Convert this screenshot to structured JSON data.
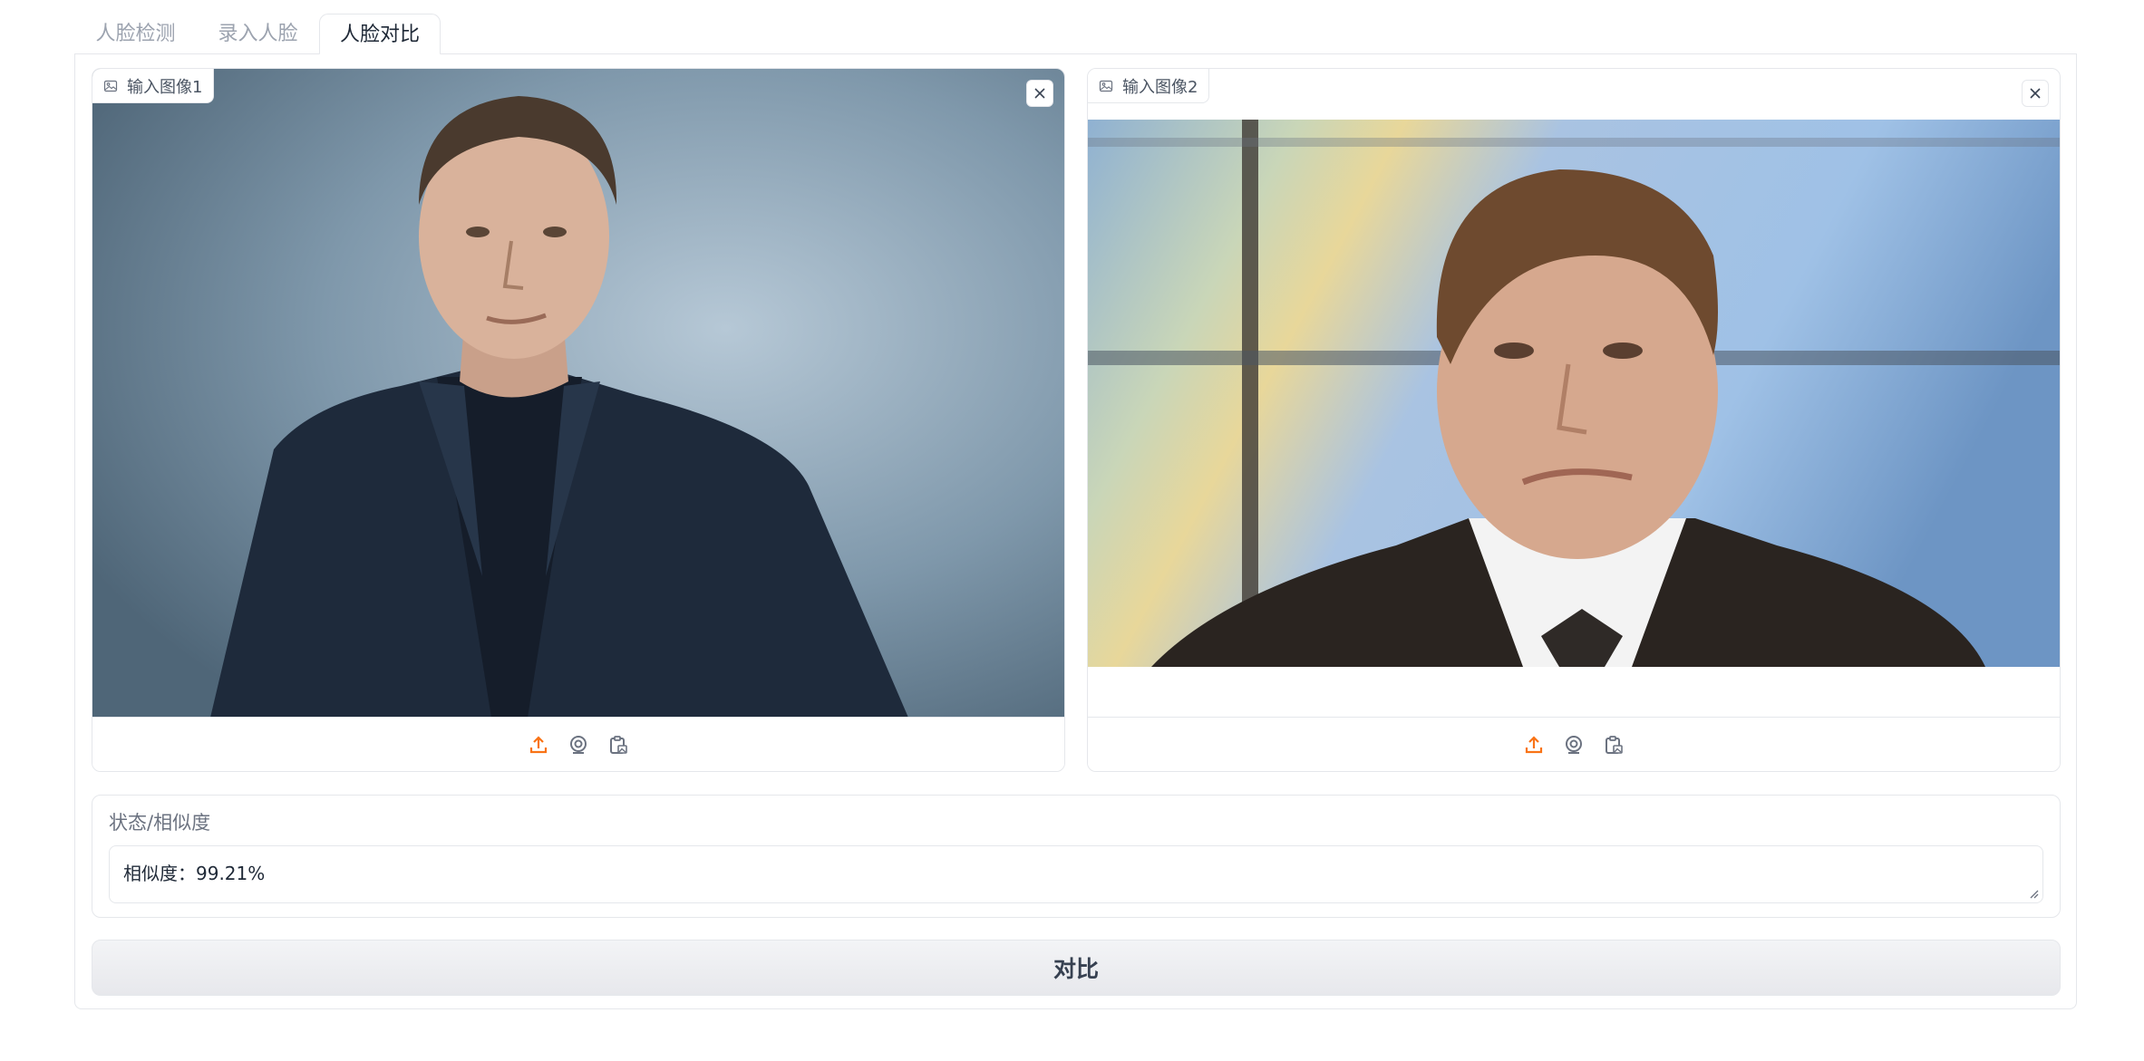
{
  "tabs": [
    {
      "label": "人脸检测",
      "active": false
    },
    {
      "label": "录入人脸",
      "active": false
    },
    {
      "label": "人脸对比",
      "active": true
    }
  ],
  "images": [
    {
      "label": "输入图像1",
      "subject": "man in dark suit on grey-blue studio background"
    },
    {
      "label": "输入图像2",
      "subject": "man in suit and tie in front of colorful window"
    }
  ],
  "source_buttons": [
    "upload-icon",
    "webcam-icon",
    "clipboard-icon"
  ],
  "status": {
    "label": "状态/相似度",
    "value": "相似度：99.21%"
  },
  "compare_button": {
    "label": "对比"
  },
  "colors": {
    "accent": "#f97316",
    "border": "#e5e7eb",
    "muted_text": "#9ca3af"
  }
}
